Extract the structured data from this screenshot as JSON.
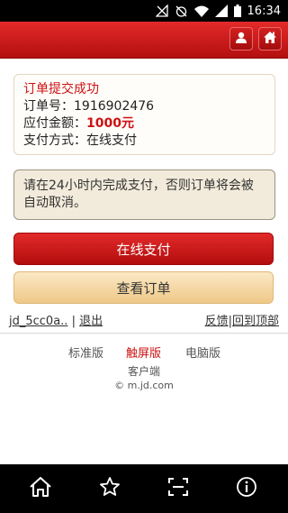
{
  "status_bar": {
    "time": "16:34",
    "icons": [
      "signal-off-icon",
      "alarm-off-icon",
      "wifi-icon",
      "mobile-signal-icon",
      "battery-icon"
    ]
  },
  "header": {
    "icons": [
      "user-icon",
      "home-icon"
    ],
    "accent_color": "#cc1111"
  },
  "order_info": {
    "success_text": "订单提交成功",
    "order_no_label": "订单号：",
    "order_no": "1916902476",
    "amount_label": "应付金额：",
    "amount": "1000元",
    "pay_method_label": "支付方式：",
    "pay_method": "在线支付"
  },
  "notice": {
    "text": "请在24小时内完成支付，否则订单将会被自动取消。"
  },
  "buttons": {
    "pay_online": "在线支付",
    "view_order": "查看订单"
  },
  "user_bar": {
    "username": "jd_5cc0a..",
    "logout": "退出",
    "feedback": "反馈",
    "back_to_top": "回到顶部",
    "separator": "|"
  },
  "footer": {
    "standard": "标准版",
    "touch": "触屏版",
    "pc": "电脑版",
    "client": "客户端",
    "copyright": "© m.jd.com"
  },
  "nav_bar": {
    "icons": [
      "home-icon",
      "star-icon",
      "scan-icon",
      "info-icon"
    ]
  }
}
